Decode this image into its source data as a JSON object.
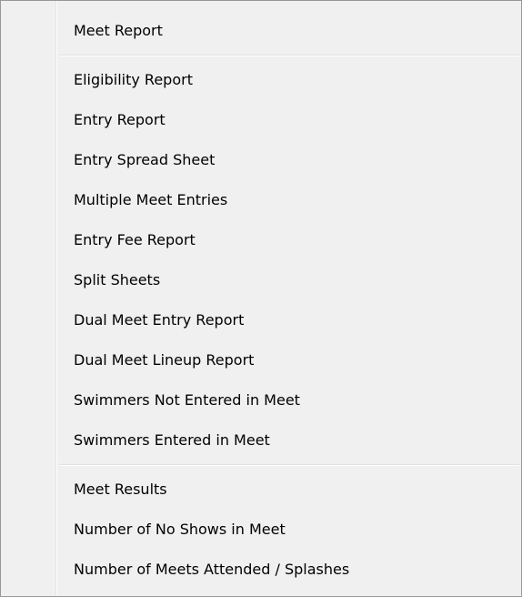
{
  "menu": {
    "groups": [
      [
        "Meet Report"
      ],
      [
        "Eligibility Report",
        "Entry Report",
        "Entry Spread Sheet",
        "Multiple Meet Entries",
        "Entry Fee Report",
        "Split Sheets",
        "Dual Meet Entry Report",
        "Dual Meet Lineup Report",
        "Swimmers Not Entered in Meet",
        "Swimmers Entered in Meet"
      ],
      [
        "Meet Results",
        "Number of No Shows in Meet",
        "Number of Meets Attended / Splashes"
      ]
    ]
  }
}
